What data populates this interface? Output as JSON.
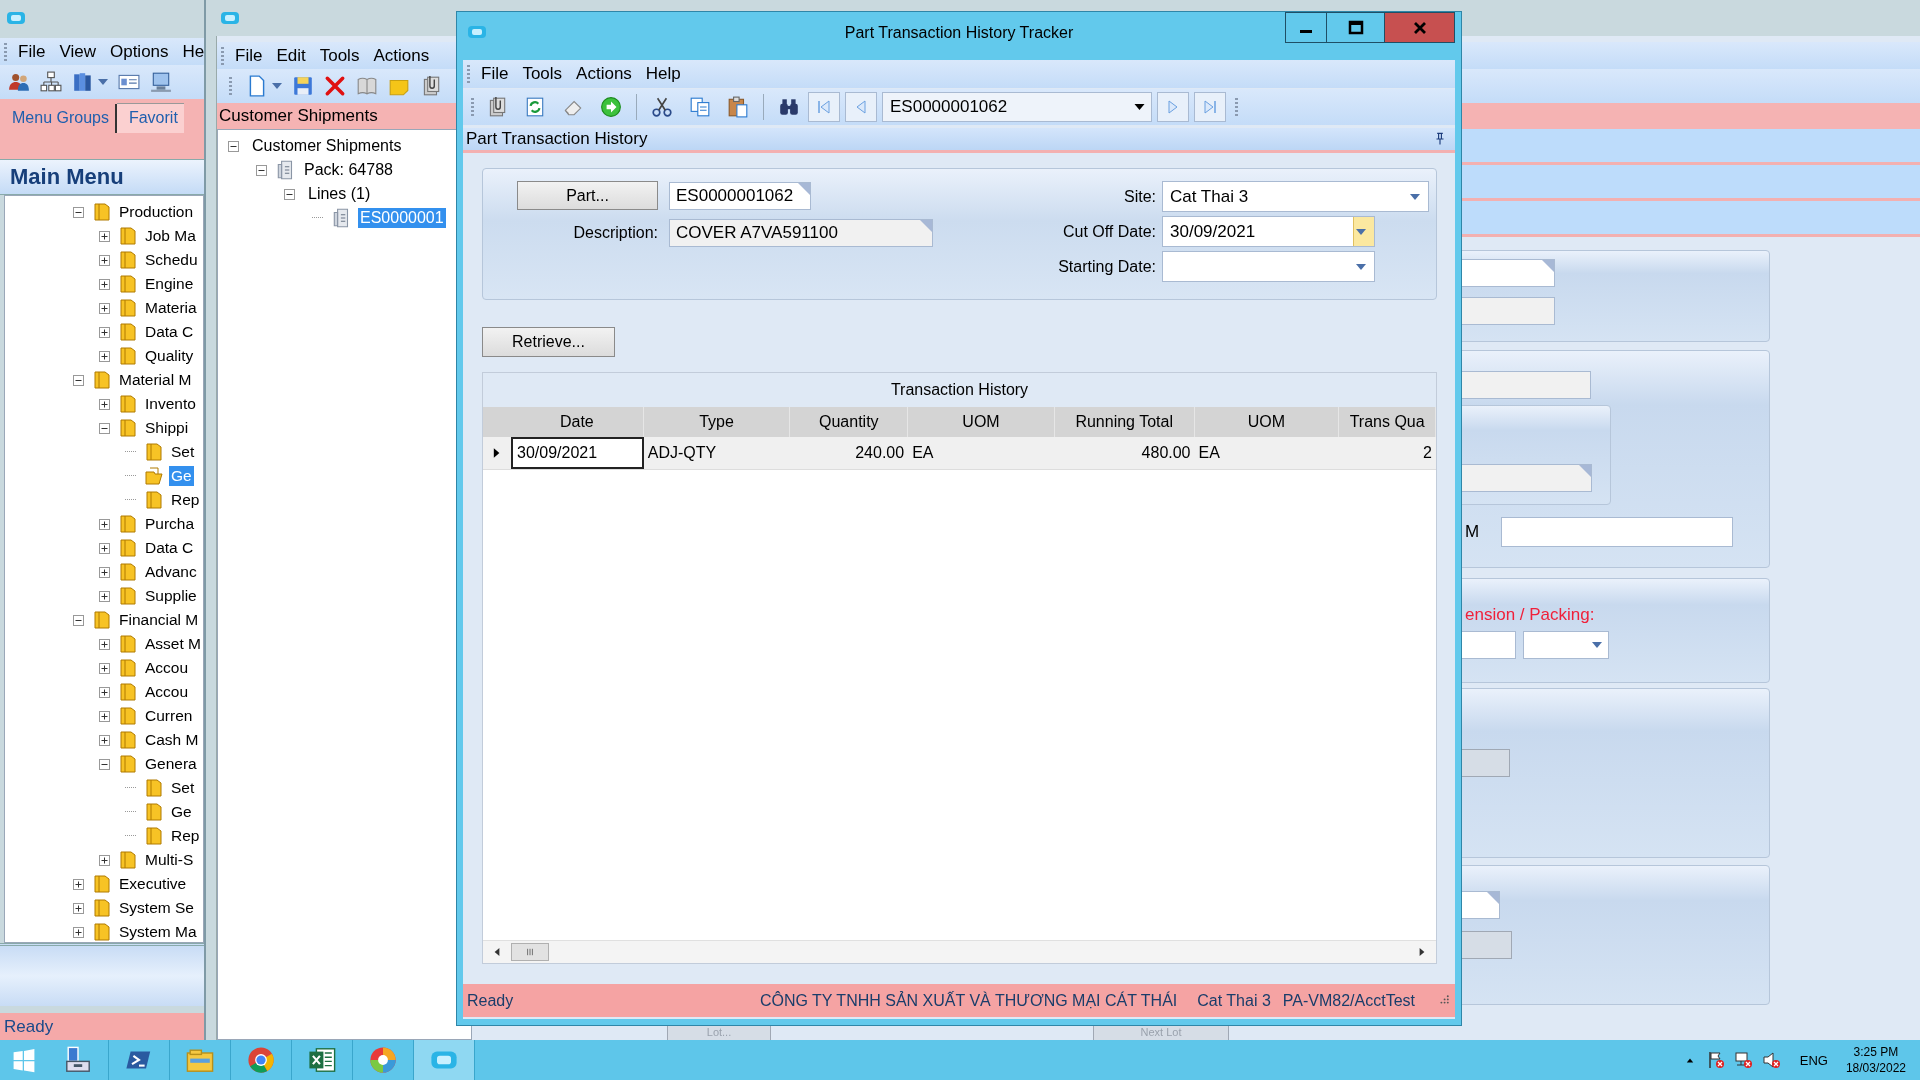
{
  "main_window": {
    "menu": [
      "File",
      "View",
      "Options",
      "He"
    ],
    "tabs": [
      {
        "label": "Menu Groups",
        "selected": true
      },
      {
        "label": "Favorit",
        "selected": false
      }
    ],
    "title": "Main Menu",
    "tree": [
      {
        "label": "Production",
        "expanded": true,
        "selected": false,
        "children": [
          {
            "label": "Job Ma",
            "expanded": false,
            "selected": false
          },
          {
            "label": "Schedu",
            "expanded": false,
            "selected": false
          },
          {
            "label": "Engine",
            "expanded": false,
            "selected": false
          },
          {
            "label": "Materia",
            "expanded": false,
            "selected": false
          },
          {
            "label": "Data C",
            "expanded": false,
            "selected": false
          },
          {
            "label": "Quality",
            "expanded": false,
            "selected": false
          }
        ]
      },
      {
        "label": "Material M",
        "expanded": true,
        "selected": false,
        "children": [
          {
            "label": "Invento",
            "expanded": false,
            "selected": false
          },
          {
            "label": "Shippi",
            "expanded": true,
            "selected": false,
            "children": [
              {
                "label": "Set",
                "selected": false
              },
              {
                "label": "Ge",
                "selected": true
              },
              {
                "label": "Rep",
                "selected": false
              }
            ]
          },
          {
            "label": "Purcha",
            "expanded": false,
            "selected": false
          },
          {
            "label": "Data C",
            "expanded": false,
            "selected": false
          },
          {
            "label": "Advanc",
            "expanded": false,
            "selected": false
          },
          {
            "label": "Supplie",
            "expanded": false,
            "selected": false
          }
        ]
      },
      {
        "label": "Financial M",
        "expanded": true,
        "selected": false,
        "children": [
          {
            "label": "Asset M",
            "expanded": false,
            "selected": false
          },
          {
            "label": "Accou",
            "expanded": false,
            "selected": false
          },
          {
            "label": "Accou",
            "expanded": false,
            "selected": false
          },
          {
            "label": "Curren",
            "expanded": false,
            "selected": false
          },
          {
            "label": "Cash M",
            "expanded": false,
            "selected": false
          },
          {
            "label": "Genera",
            "expanded": true,
            "selected": false,
            "children": [
              {
                "label": "Set",
                "selected": false
              },
              {
                "label": "Ge",
                "selected": false
              },
              {
                "label": "Rep",
                "selected": false
              }
            ]
          },
          {
            "label": "Multi-S",
            "expanded": false,
            "selected": false
          }
        ]
      },
      {
        "label": "Executive",
        "expanded": false,
        "selected": false
      },
      {
        "label": "System Se",
        "expanded": false,
        "selected": false
      },
      {
        "label": "System Ma",
        "expanded": false,
        "selected": false
      }
    ],
    "status": "Ready"
  },
  "shipments_window": {
    "menu": [
      "File",
      "Edit",
      "Tools",
      "Actions"
    ],
    "header": "Customer Shipments",
    "tree": [
      {
        "label": "Customer Shipments",
        "kind": "plain",
        "expanded": true,
        "selected": false,
        "children": [
          {
            "label": "Pack: 64788",
            "kind": "document",
            "expanded": true,
            "selected": false,
            "children": [
              {
                "label": "Lines (1)",
                "kind": "plain",
                "expanded": true,
                "selected": false,
                "children": [
                  {
                    "label": "ES0000001",
                    "kind": "document",
                    "selected": true
                  }
                ]
              }
            ]
          }
        ]
      }
    ],
    "uom_label": "M",
    "packing_label": "ension / Packing:",
    "lot_buttons": [
      "Lot...",
      "Next Lot"
    ]
  },
  "dialog": {
    "title": "Part Transaction History Tracker",
    "menu": [
      "File",
      "Tools",
      "Actions",
      "Help"
    ],
    "record_selector": "ES0000001062",
    "panel_title": "Part Transaction History",
    "part_button": "Part...",
    "part_value": "ES0000001062",
    "description_label": "Description:",
    "description_value": "COVER A7VA591100",
    "site_label": "Site:",
    "site_value": "Cat Thai 3",
    "cutoff_label": "Cut Off Date:",
    "cutoff_value": "30/09/2021",
    "starting_label": "Starting Date:",
    "retrieve_button": "Retrieve...",
    "grid": {
      "title": "Transaction History",
      "columns": [
        "Date",
        "Type",
        "Quantity",
        "UOM",
        "Running Total",
        "UOM",
        "Trans Qua"
      ],
      "rows": [
        {
          "selected": true,
          "cells": [
            "30/09/2021",
            "ADJ-QTY",
            "240.00",
            "EA",
            "480.00",
            "EA",
            "2"
          ]
        }
      ]
    },
    "status_bar": [
      "Ready",
      "CÔNG TY TNHH SẢN XUẤT VÀ THƯƠNG MẠI CÁT THÁI",
      "Cat Thai 3",
      "PA-VM82/AcctTest"
    ]
  },
  "taskbar": {
    "apps": [
      {
        "selected": false
      },
      {
        "selected": false
      },
      {
        "selected": false
      },
      {
        "selected": false
      },
      {
        "selected": false
      },
      {
        "selected": false
      },
      {
        "selected": true
      }
    ],
    "language": "ENG",
    "time": "3:25 PM",
    "date": "18/03/2022"
  }
}
